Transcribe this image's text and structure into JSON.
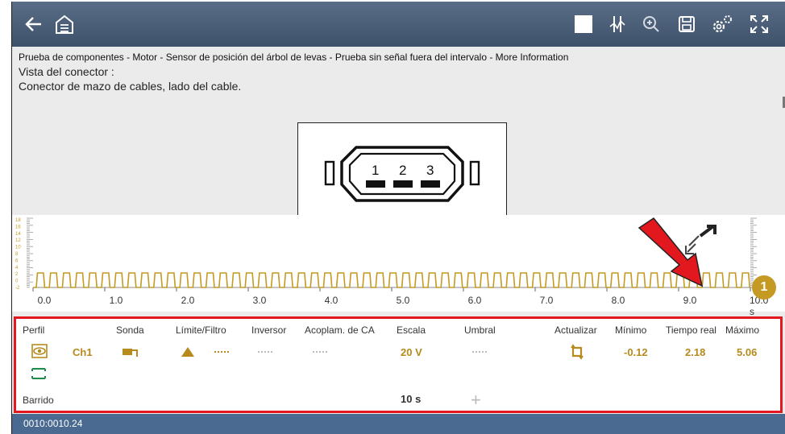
{
  "topbar": {
    "icons": [
      "back-arrow-icon",
      "home-garage-icon",
      "stop-icon",
      "cursor-icon",
      "zoom-icon",
      "save-icon",
      "settings-icon",
      "fullscreen-icon"
    ]
  },
  "breadcrumb": "Prueba de componentes - Motor - Sensor de posición del árbol de levas - Prueba sin señal fuera del intervalo - More Information",
  "connector": {
    "view_label": "Vista del conector :",
    "description": "Conector de mazo de cables, lado del cable.",
    "pins": [
      "1",
      "2",
      "3"
    ]
  },
  "scope": {
    "x_ticks": [
      "0.0",
      "1.0",
      "2.0",
      "3.0",
      "4.0",
      "5.0",
      "6.0",
      "7.0",
      "8.0",
      "9.0",
      "10.0 s"
    ],
    "y_ticks": [
      "18",
      "16",
      "14",
      "12",
      "10",
      "8",
      "6",
      "4",
      "2",
      "0",
      "-2"
    ],
    "cursor_badge": "1",
    "signal_color": "#c49a22"
  },
  "panel": {
    "headers": {
      "perfil": "Perfil",
      "sonda": "Sonda",
      "limite": "Límite/Filtro",
      "inversor": "Inversor",
      "acoplam": "Acoplam. de CA",
      "escala": "Escala",
      "umbral": "Umbral",
      "actualizar": "Actualizar",
      "minimo": "Mínimo",
      "tiempo": "Tiempo real",
      "maximo": "Máximo"
    },
    "channel": {
      "name": "Ch1",
      "escala": "20 V",
      "minimo": "-0.12",
      "tiempo_real": "2.18",
      "maximo": "5.06"
    },
    "barrido_label": "Barrido",
    "barrido_value": "10 s",
    "accent_color": "#b78a1d",
    "border_color": "#e3181f"
  },
  "status": {
    "text": "0010:0010.24"
  }
}
